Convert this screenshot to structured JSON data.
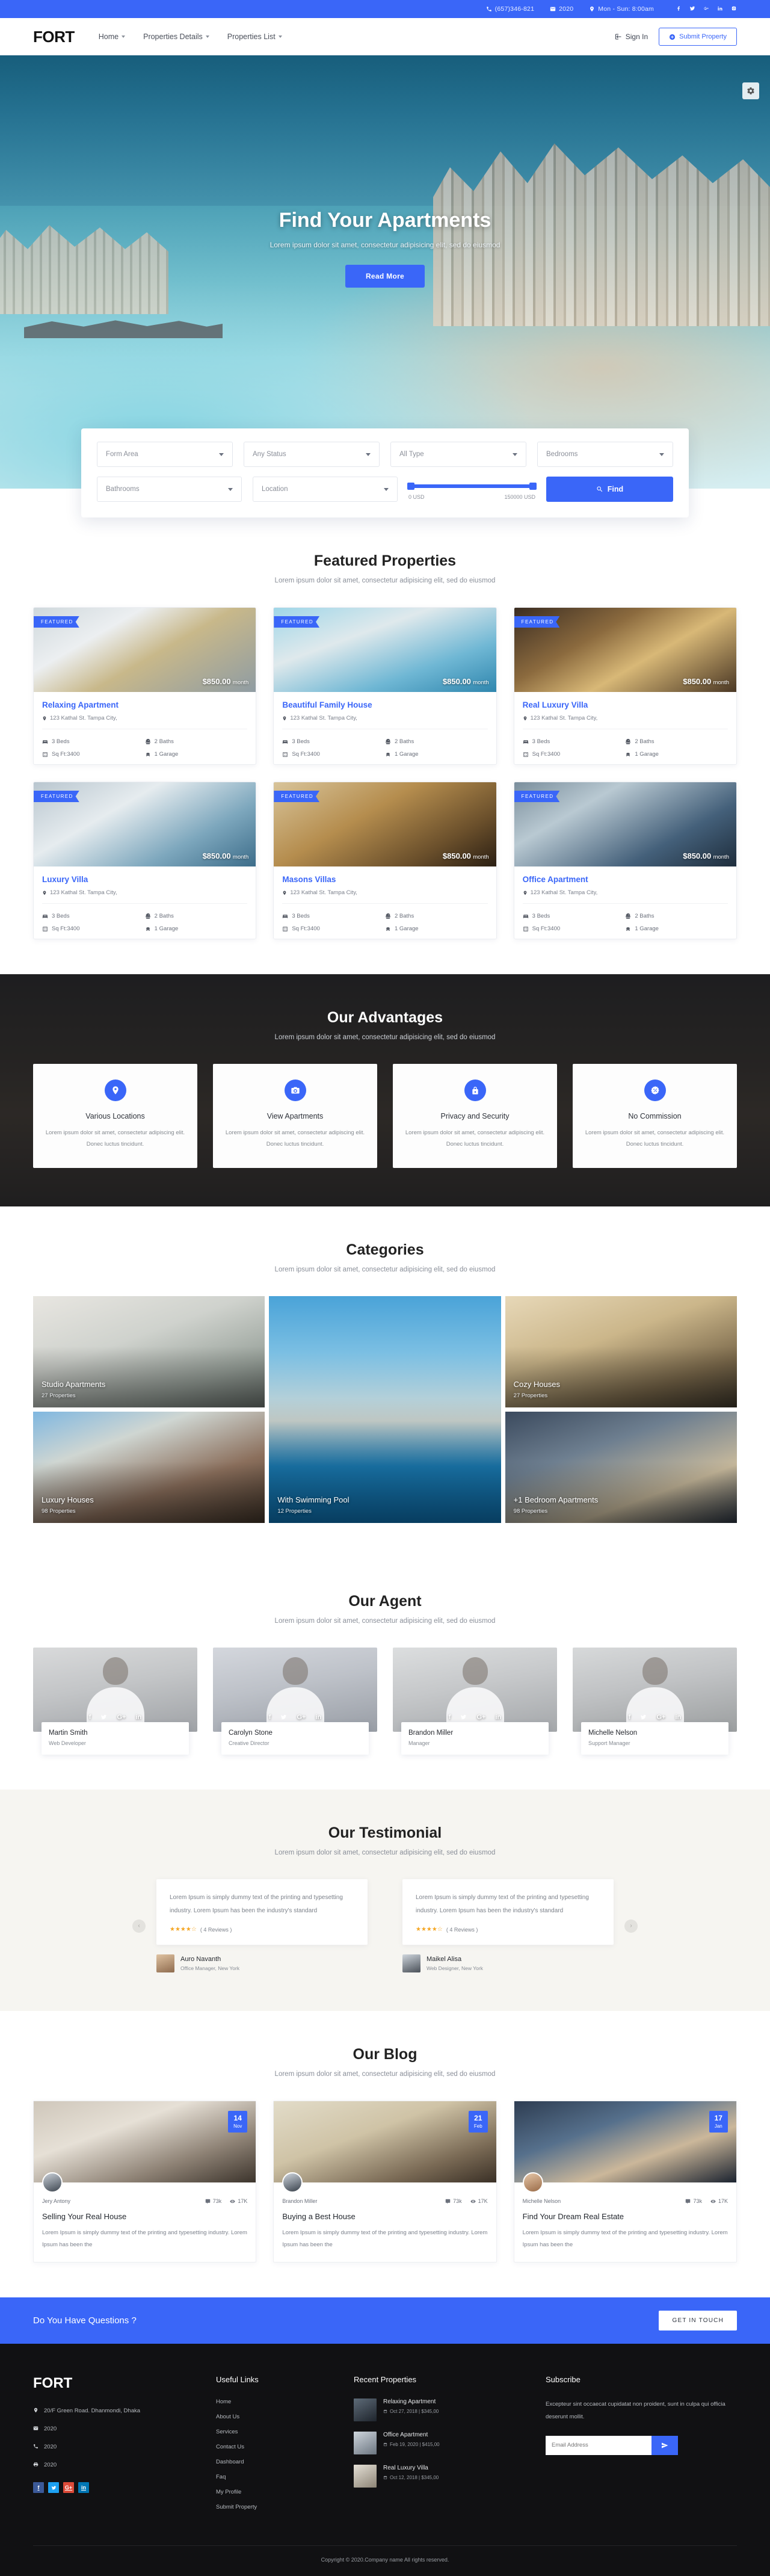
{
  "topbar": {
    "phone": "(657)346-821",
    "email": "2020",
    "hours": "Mon - Sun: 8:00am",
    "socials": [
      "facebook-icon",
      "twitter-icon",
      "google-plus-icon",
      "linkedin-icon",
      "instagram-icon"
    ]
  },
  "nav": {
    "logo": "FORT",
    "links": [
      {
        "label": "Home",
        "caret": true
      },
      {
        "label": "Properties Details",
        "caret": true
      },
      {
        "label": "Properties List",
        "caret": true
      }
    ],
    "sign_in": "Sign In",
    "submit_property": "Submit Property"
  },
  "hero": {
    "title": "Find Your Apartments",
    "subtitle": "Lorem ipsum dolor sit amet, consectetur adipisicing elit, sed do eiusmod",
    "button": "Read More"
  },
  "search": {
    "form_area": "Form Area",
    "any_status": "Any Status",
    "all_type": "All Type",
    "bedrooms": "Bedrooms",
    "bathrooms": "Bathrooms",
    "location": "Location",
    "price_min": "0 USD",
    "price_max": "150000 USD",
    "find": "Find"
  },
  "featured": {
    "title": "Featured Properties",
    "subtitle": "Lorem ipsum dolor sit amet, consectetur adipisicing elit, sed do eiusmod",
    "badge": "FEATURED",
    "properties": [
      {
        "name": "Relaxing Apartment",
        "price": "$850.00",
        "period": "month",
        "address": "123 Kathal St. Tampa City,",
        "beds": "3 Beds",
        "baths": "2 Baths",
        "sqft": "Sq Ft:3400",
        "garage": "1 Garage"
      },
      {
        "name": "Beautiful Family House",
        "price": "$850.00",
        "period": "month",
        "address": "123 Kathal St. Tampa City,",
        "beds": "3 Beds",
        "baths": "2 Baths",
        "sqft": "Sq Ft:3400",
        "garage": "1 Garage"
      },
      {
        "name": "Real Luxury Villa",
        "price": "$850.00",
        "period": "month",
        "address": "123 Kathal St. Tampa City,",
        "beds": "3 Beds",
        "baths": "2 Baths",
        "sqft": "Sq Ft:3400",
        "garage": "1 Garage"
      },
      {
        "name": "Luxury Villa",
        "price": "$850.00",
        "period": "month",
        "address": "123 Kathal St. Tampa City,",
        "beds": "3 Beds",
        "baths": "2 Baths",
        "sqft": "Sq Ft:3400",
        "garage": "1 Garage"
      },
      {
        "name": "Masons Villas",
        "price": "$850.00",
        "period": "month",
        "address": "123 Kathal St. Tampa City,",
        "beds": "3 Beds",
        "baths": "2 Baths",
        "sqft": "Sq Ft:3400",
        "garage": "1 Garage"
      },
      {
        "name": "Office Apartment",
        "price": "$850.00",
        "period": "month",
        "address": "123 Kathal St. Tampa City,",
        "beds": "3 Beds",
        "baths": "2 Baths",
        "sqft": "Sq Ft:3400",
        "garage": "1 Garage"
      }
    ]
  },
  "advantages": {
    "title": "Our Advantages",
    "subtitle": "Lorem ipsum dolor sit amet, consectetur adipisicing elit, sed do eiusmod",
    "items": [
      {
        "icon": "map-pin-icon",
        "name": "Various Locations",
        "text": "Lorem ipsum dolor sit amet, consectetur adipiscing elit. Donec luctus tincidunt."
      },
      {
        "icon": "camera-icon",
        "name": "View Apartments",
        "text": "Lorem ipsum dolor sit amet, consectetur adipiscing elit. Donec luctus tincidunt."
      },
      {
        "icon": "lock-icon",
        "name": "Privacy and Security",
        "text": "Lorem ipsum dolor sit amet, consectetur adipiscing elit. Donec luctus tincidunt."
      },
      {
        "icon": "percent-badge-icon",
        "name": "No Commission",
        "text": "Lorem ipsum dolor sit amet, consectetur adipiscing elit. Donec luctus tincidunt."
      }
    ]
  },
  "categories": {
    "title": "Categories",
    "subtitle": "Lorem ipsum dolor sit amet, consectetur adipisicing elit, sed do eiusmod",
    "items": [
      {
        "name": "Studio Apartments",
        "count": "27 Properties"
      },
      {
        "name": "With Swimming Pool",
        "count": "12 Properties"
      },
      {
        "name": "Cozy Houses",
        "count": "27 Properties"
      },
      {
        "name": "Luxury Houses",
        "count": "98 Properties"
      },
      {
        "name": "+1 Bedroom Apartments",
        "count": "98 Properties"
      }
    ]
  },
  "agents": {
    "title": "Our Agent",
    "subtitle": "Lorem ipsum dolor sit amet, consectetur adipisicing elit, sed do eiusmod",
    "items": [
      {
        "name": "Martin Smith",
        "role": "Web Developer"
      },
      {
        "name": "Carolyn Stone",
        "role": "Creative Director"
      },
      {
        "name": "Brandon Miller",
        "role": "Manager"
      },
      {
        "name": "Michelle Nelson",
        "role": "Support Manager"
      }
    ]
  },
  "testimonial": {
    "title": "Our Testimonial",
    "subtitle": "Lorem ipsum dolor sit amet, consectetur adipisicing elit, sed do eiusmod",
    "prev": "‹",
    "next": "›",
    "items": [
      {
        "text": "Lorem Ipsum is simply dummy text of the printing and typesetting industry. Lorem Ipsum has been the industry's standard",
        "stars": "★★★★☆",
        "reviews": "( 4 Reviews )",
        "name": "Auro Navanth",
        "role": "Office Manager, New York"
      },
      {
        "text": "Lorem Ipsum is simply dummy text of the printing and typesetting industry. Lorem Ipsum has been the industry's standard",
        "stars": "★★★★☆",
        "reviews": "( 4 Reviews )",
        "name": "Maikel Alisa",
        "role": "Web Designer, New York"
      }
    ]
  },
  "blog": {
    "title": "Our Blog",
    "subtitle": "Lorem ipsum dolor sit amet, consectetur adipisicing elit, sed do eiusmod",
    "posts": [
      {
        "day": "14",
        "month": "Nov",
        "author": "Jery Antony",
        "comments": "73k",
        "views": "17K",
        "title": "Selling Your Real House",
        "text": "Lorem Ipsum is simply dummy text of the printing and typesetting industry. Lorem Ipsum has been the"
      },
      {
        "day": "21",
        "month": "Feb",
        "author": "Brandon Miller",
        "comments": "73k",
        "views": "17K",
        "title": "Buying a Best House",
        "text": "Lorem Ipsum is simply dummy text of the printing and typesetting industry. Lorem Ipsum has been the"
      },
      {
        "day": "17",
        "month": "Jan",
        "author": "Michelle Nelson",
        "comments": "73k",
        "views": "17K",
        "title": "Find Your Dream Real Estate",
        "text": "Lorem Ipsum is simply dummy text of the printing and typesetting industry. Lorem Ipsum has been the"
      }
    ]
  },
  "cta": {
    "text": "Do You Have Questions ?",
    "button": "GET IN TOUCH"
  },
  "footer": {
    "logo": "FORT",
    "address": "20/F Green Road. Dhanmondi, Dhaka",
    "email": "2020",
    "phone": "2020",
    "fax": "2020",
    "socials": [
      "facebook-icon",
      "twitter-icon",
      "google-plus-icon",
      "linkedin-icon"
    ],
    "useful_links_title": "Useful Links",
    "useful_links": [
      "Home",
      "About Us",
      "Services",
      "Contact Us",
      "Dashboard",
      "Faq",
      "My Profile",
      "Submit Property"
    ],
    "recent_title": "Recent Properties",
    "recent": [
      {
        "name": "Relaxing Apartment",
        "meta": "Oct 27, 2018 | $345,00"
      },
      {
        "name": "Office Apartment",
        "meta": "Feb 19, 2020 | $415,00"
      },
      {
        "name": "Real Luxury Villa",
        "meta": "Oct 12, 2018 | $345,00"
      }
    ],
    "subscribe_title": "Subscribe",
    "subscribe_text": "Excepteur sint occaecat cupidatat non proident, sunt in culpa qui officia deserunt mollit.",
    "email_placeholder": "Email Address",
    "copyright": "Copyright © 2020.Company name All rights reserved."
  },
  "colors": {
    "accent": "#3a66f8",
    "dark": "#111113",
    "star": "#f5a623"
  }
}
